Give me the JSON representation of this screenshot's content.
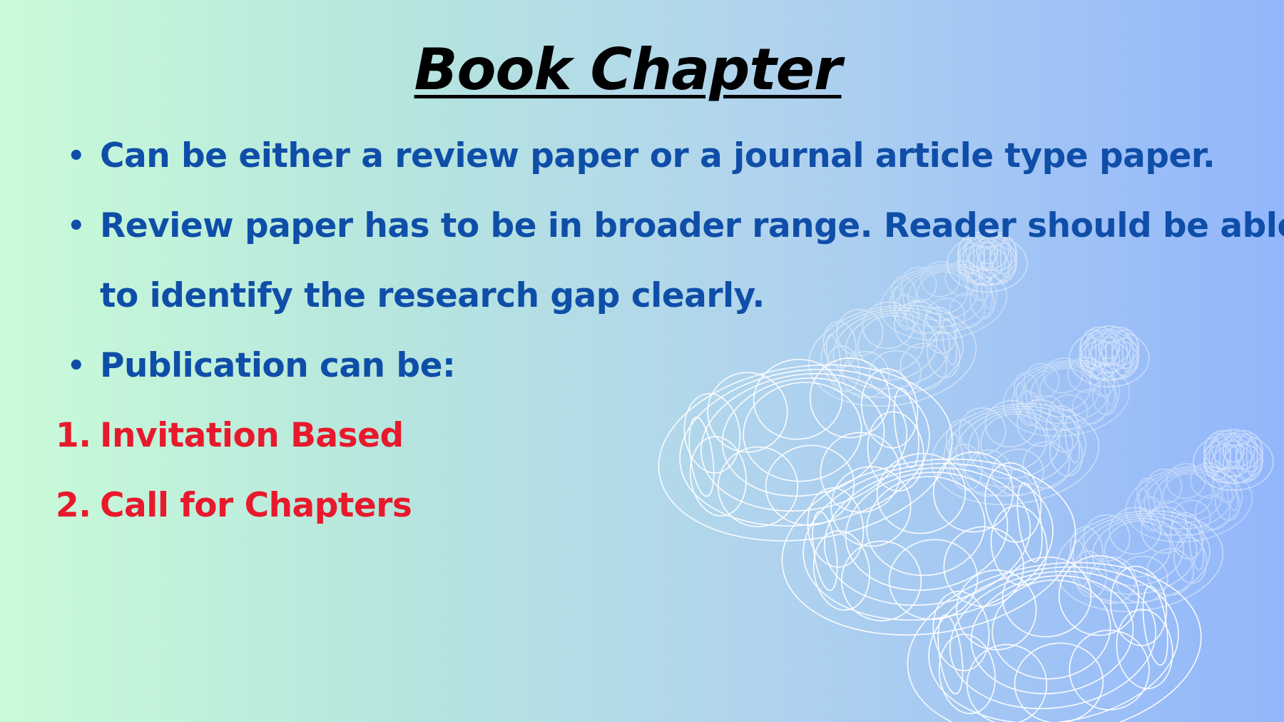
{
  "slide": {
    "title": "Book Chapter",
    "bullets": [
      {
        "lines": [
          "Can be either a review paper or a journal article type paper."
        ]
      },
      {
        "lines": [
          "Review paper has to be in broader range. Reader should be able",
          "to identify the research gap clearly."
        ]
      },
      {
        "lines": [
          "Publication can be:"
        ]
      }
    ],
    "numbered": [
      {
        "marker": "1.",
        "text": "Invitation Based"
      },
      {
        "marker": "2.",
        "text": "Call for Chapters"
      }
    ],
    "bullet_symbol": "•",
    "colors": {
      "title": "#000000",
      "bullet_text": "#0f4ea8",
      "numbered_text": "#e8192c",
      "background_left": "#c9fbd8",
      "background_right": "#92b6fb",
      "decoration": "#ffffff"
    },
    "decoration_icon": "wireframe-torus-icon"
  }
}
